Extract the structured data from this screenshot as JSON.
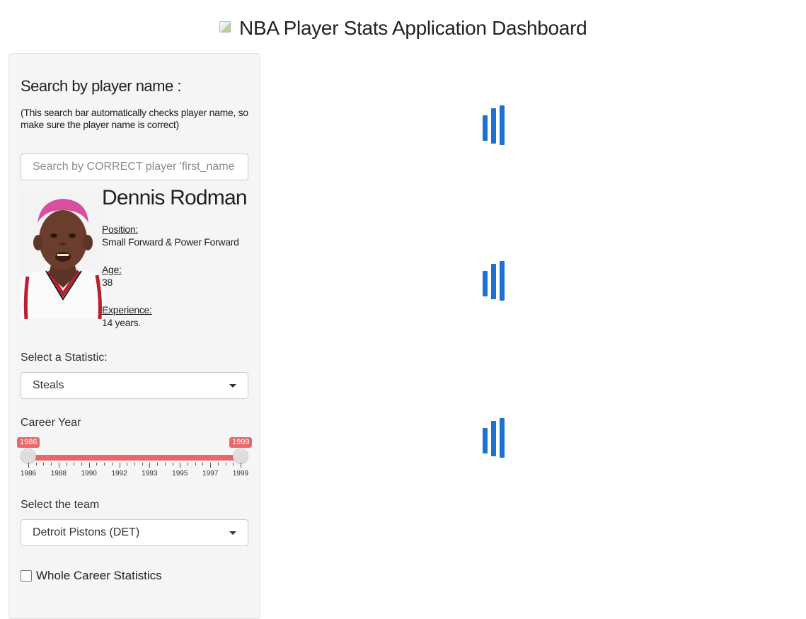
{
  "header": {
    "title": "NBA Player Stats Application Dashboard",
    "logo_icon": "broken-image-icon"
  },
  "sidebar": {
    "search_heading": "Search by player name :",
    "search_note": "(This search bar automatically checks player name, so make sure the player name is correct)",
    "search_placeholder": "Search by CORRECT player 'first_name last_name'",
    "player": {
      "name": "Dennis Rodman",
      "position_label": "Position:",
      "position_value": "Small Forward & Power Forward",
      "age_label": "Age:",
      "age_value": "38",
      "experience_label": "Experience:",
      "experience_value": "14 years."
    },
    "statistic": {
      "label": "Select a Statistic:",
      "selected": "Steals"
    },
    "career_year": {
      "label": "Career Year",
      "min_value": "1986",
      "max_value": "1999",
      "range_fraction": [
        0.0,
        1.0
      ],
      "ticks": [
        "1986",
        "1988",
        "1990",
        "1992",
        "1993",
        "1995",
        "1997",
        "1999"
      ]
    },
    "team": {
      "label": "Select the team",
      "selected": "Detroit Pistons (DET)"
    },
    "whole_career": {
      "label": "Whole Career Statistics",
      "checked": false
    }
  },
  "main": {
    "spinners": [
      "loading-spinner",
      "loading-spinner",
      "loading-spinner"
    ]
  },
  "colors": {
    "accent": "#e8686a",
    "spinner": "#1a73d2",
    "sidebar_bg": "#f5f5f5"
  }
}
